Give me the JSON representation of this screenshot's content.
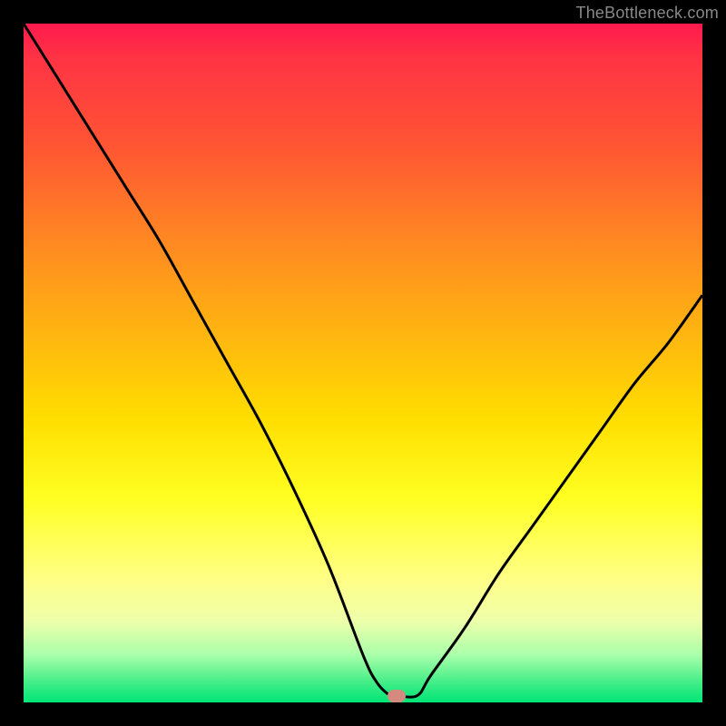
{
  "watermark": "TheBottleneck.com",
  "chart_data": {
    "type": "line",
    "title": "",
    "xlabel": "",
    "ylabel": "",
    "xlim": [
      0,
      100
    ],
    "ylim": [
      0,
      100
    ],
    "series": [
      {
        "name": "bottleneck-curve",
        "x": [
          0,
          5,
          10,
          15,
          20,
          25,
          30,
          35,
          40,
          45,
          50,
          52,
          54,
          55,
          58,
          60,
          65,
          70,
          75,
          80,
          85,
          90,
          95,
          100
        ],
        "values": [
          100,
          92,
          84,
          76,
          68,
          59,
          50,
          41,
          31,
          20,
          7,
          3,
          1,
          1,
          1,
          4,
          11,
          19,
          26,
          33,
          40,
          47,
          53,
          60
        ]
      }
    ],
    "marker": {
      "x": 55,
      "y": 1
    },
    "background_gradient": {
      "stops": [
        {
          "pos": 0,
          "color": "#ff1a4d"
        },
        {
          "pos": 5,
          "color": "#ff3344"
        },
        {
          "pos": 18,
          "color": "#ff5533"
        },
        {
          "pos": 32,
          "color": "#ff8822"
        },
        {
          "pos": 45,
          "color": "#ffb311"
        },
        {
          "pos": 58,
          "color": "#ffdd00"
        },
        {
          "pos": 70,
          "color": "#ffff22"
        },
        {
          "pos": 82,
          "color": "#ffff88"
        },
        {
          "pos": 88,
          "color": "#eeffaa"
        },
        {
          "pos": 93,
          "color": "#aaffaa"
        },
        {
          "pos": 97,
          "color": "#44ee88"
        },
        {
          "pos": 100,
          "color": "#00e577"
        }
      ]
    }
  }
}
